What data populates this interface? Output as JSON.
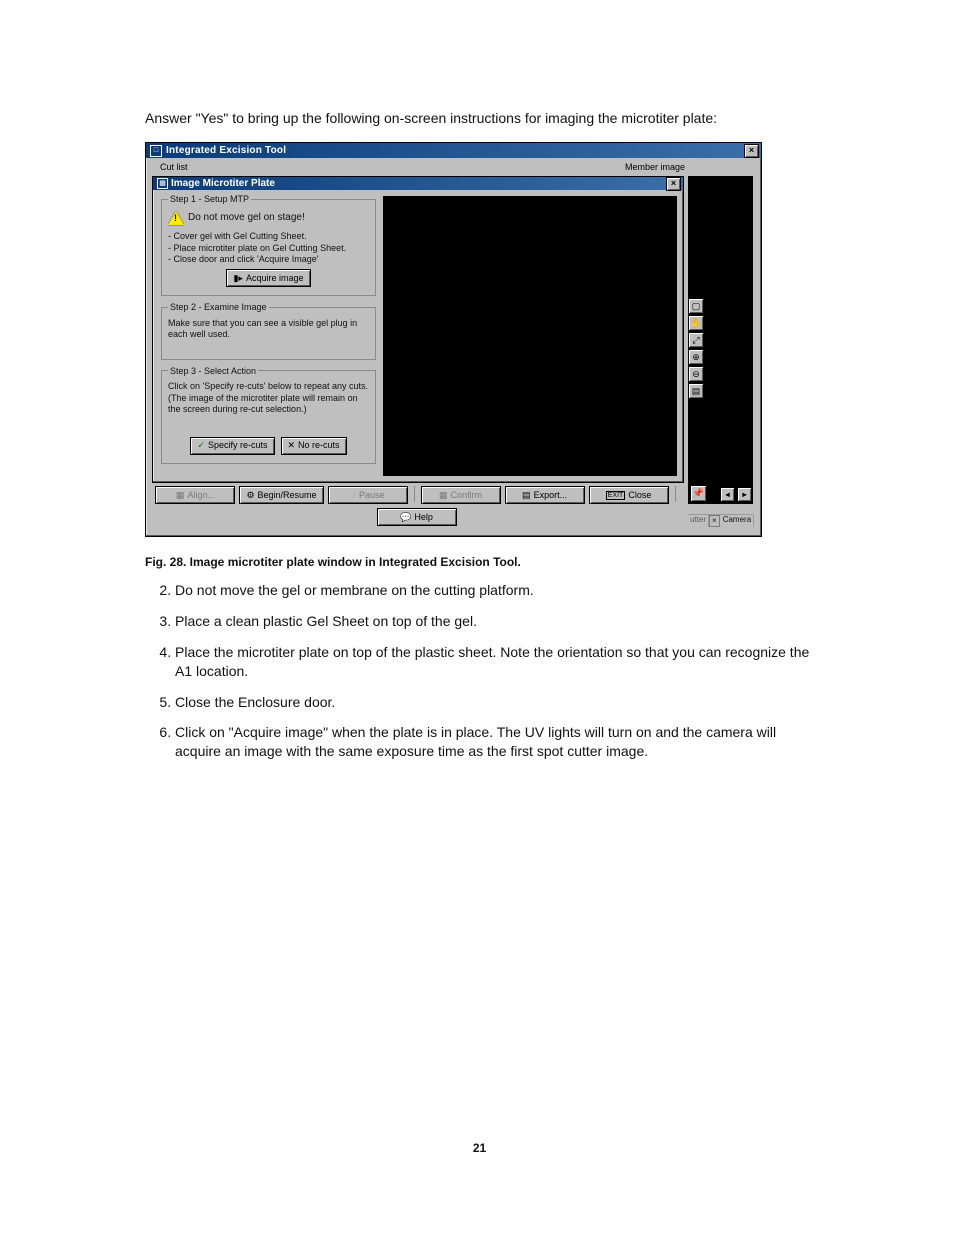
{
  "intro": "Answer \"Yes\" to bring up the following on-screen instructions for imaging the microtiter plate:",
  "outerWindow": {
    "title": "Integrated Excision Tool",
    "closeGlyph": "×",
    "peekLeft": "Cut list",
    "peekRight": "Member image",
    "thumb": {
      "tabOn": "Camera",
      "tabOff": "utter",
      "pinGlyph": "📌"
    }
  },
  "innerWindow": {
    "title": "Image Microtiter Plate",
    "step1": {
      "legend": "Step 1 - Setup MTP",
      "warn": "Do not move gel on stage!",
      "b1": "- Cover gel with Gel Cutting Sheet.",
      "b2": "- Place microtiter plate on Gel Cutting Sheet.",
      "b3": "- Close door and click 'Acquire Image'",
      "acquire": "Acquire image"
    },
    "step2": {
      "legend": "Step 2 - Examine Image",
      "text": "Make sure that you can see a visible gel plug in each well used."
    },
    "step3": {
      "legend": "Step 3 - Select Action",
      "t1": "Click on 'Specify re-cuts' below to repeat any cuts.",
      "t2": "(The image of the microtiter plate will remain on the screen during re-cut selection.)",
      "btnSpecify": "Specify re-cuts",
      "btnNo": "No re-cuts"
    }
  },
  "vtool": {
    "fit": "▢",
    "hand": "✋",
    "zoom": "⤢",
    "zoomIn": "⊕",
    "zoomOut": "⊖",
    "hist": "▤"
  },
  "cmd": {
    "align": "Align...",
    "begin": "Begin/Resume",
    "pause": "Pause",
    "confirm": "Confirm",
    "export": "Export...",
    "close": "Close",
    "help": "Help"
  },
  "caption": "Fig. 28.  Image microtiter plate window in Integrated Excision Tool.",
  "list": {
    "i2": "Do not move the gel or membrane on the cutting platform.",
    "i3": "Place a clean plastic Gel Sheet on top of the gel.",
    "i4": "Place the microtiter plate on top of the plastic sheet. Note the orientation so that you can recognize the A1 location.",
    "i5": "Close the Enclosure door.",
    "i6": "Click on \"Acquire image\" when the plate is in place. The UV lights will turn on and the camera will acquire an image with the same exposure time as the first spot cutter image."
  },
  "pageNumber": "21"
}
